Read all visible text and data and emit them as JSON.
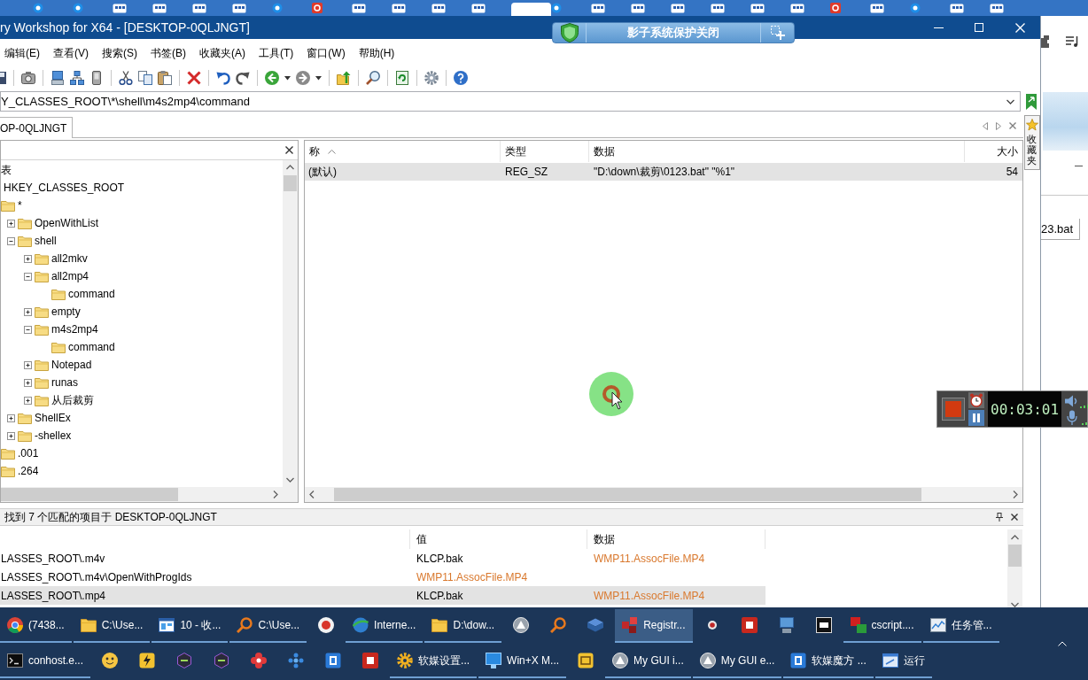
{
  "window": {
    "title": "ry Workshop for X64 - [DESKTOP-0QLJNGT]"
  },
  "overlay_bar": {
    "label": "影子系统保护关闭"
  },
  "menu": [
    "编辑(E)",
    "查看(V)",
    "搜索(S)",
    "书签(B)",
    "收藏夹(A)",
    "工具(T)",
    "窗口(W)",
    "帮助(H)"
  ],
  "address_bar": {
    "value": "Y_CLASSES_ROOT\\*\\shell\\m4s2mp4\\command"
  },
  "tabs": [
    {
      "label": "OP-0QLJNGT",
      "selected": true
    }
  ],
  "favorites_tab": {
    "label": "收藏夹"
  },
  "tree": {
    "items": [
      {
        "label": "表",
        "children": [
          {
            "label": "HKEY_CLASSES_ROOT",
            "children": [
              {
                "label": "*",
                "children": [
                  {
                    "label": "OpenWithList",
                    "expanded": false
                  },
                  {
                    "label": "shell",
                    "expanded": true,
                    "children": [
                      {
                        "label": "all2mkv",
                        "expanded": false
                      },
                      {
                        "label": "all2mp4",
                        "expanded": true,
                        "children": [
                          {
                            "label": "command"
                          }
                        ]
                      },
                      {
                        "label": "empty",
                        "expanded": false
                      },
                      {
                        "label": "m4s2mp4",
                        "expanded": true,
                        "children": [
                          {
                            "label": "command"
                          }
                        ]
                      },
                      {
                        "label": "Notepad",
                        "expanded": false
                      },
                      {
                        "label": "runas",
                        "expanded": false
                      },
                      {
                        "label": "从后裁剪",
                        "expanded": false
                      }
                    ]
                  },
                  {
                    "label": "ShellEx",
                    "expanded": false
                  },
                  {
                    "label": "-shellex",
                    "expanded": false
                  }
                ]
              },
              {
                "label": ".001"
              },
              {
                "label": ".264"
              }
            ]
          }
        ]
      }
    ]
  },
  "values_list": {
    "columns": [
      {
        "label": "称",
        "sort_ascending": true
      },
      {
        "label": "类型"
      },
      {
        "label": "数据"
      },
      {
        "label": "大小"
      }
    ],
    "rows": [
      {
        "name": "(默认)",
        "type": "REG_SZ",
        "data": "\"D:\\down\\裁剪\\0123.bat\" \"%1\"",
        "size": "54",
        "selected": true
      }
    ]
  },
  "search_results": {
    "title": "找到 7 个匹配的项目于 DESKTOP-0QLJNGT",
    "columns": [
      "值",
      "数据"
    ],
    "rows": [
      {
        "key": "LASSES_ROOT\\.m4v",
        "value": {
          "text": "KLCP.bak",
          "matched": false
        },
        "data": {
          "text": "WMP11.AssocFile.MP4",
          "matched": true
        },
        "selected": false
      },
      {
        "key": "LASSES_ROOT\\.m4v\\OpenWithProgIds",
        "value": {
          "text": "WMP11.AssocFile.MP4",
          "matched": true
        },
        "selected": false
      },
      {
        "key": "LASSES_ROOT\\.mp4",
        "value": {
          "text": "KLCP.bak",
          "matched": false
        },
        "data": {
          "text": "WMP11.AssocFile.MP4",
          "matched": true
        },
        "selected": true
      }
    ]
  },
  "recorder": {
    "timer": "00:03:01"
  },
  "background_window": {
    "tab": "23.bat"
  },
  "taskbar": {
    "top_row": [
      {
        "kind": "labeled",
        "label": "(7438...",
        "active": false
      },
      {
        "kind": "labeled",
        "label": "C:\\Use...",
        "active": false
      },
      {
        "kind": "labeled",
        "label": "10 - 收...",
        "active": false
      },
      {
        "kind": "labeled",
        "label": "C:\\Use...",
        "active": false
      },
      {
        "kind": "icon",
        "active": false
      },
      {
        "kind": "labeled",
        "label": "Interne...",
        "active": false
      },
      {
        "kind": "labeled",
        "label": "D:\\dow...",
        "active": false
      },
      {
        "kind": "icon",
        "active": false
      },
      {
        "kind": "icon",
        "active": false
      },
      {
        "kind": "icon",
        "active": false
      },
      {
        "kind": "labeled",
        "label": "Registr...",
        "active": true
      },
      {
        "kind": "icon",
        "active": false
      },
      {
        "kind": "icon",
        "active": false
      },
      {
        "kind": "icon",
        "active": false
      },
      {
        "kind": "icon",
        "active": false
      },
      {
        "kind": "labeled",
        "label": "cscript....",
        "active": false
      },
      {
        "kind": "labeled",
        "label": "任务管...",
        "active": false
      }
    ],
    "bottom_row": [
      {
        "kind": "labeled",
        "label": "conhost.e...",
        "active": false
      },
      {
        "kind": "icon",
        "active": false
      },
      {
        "kind": "icon",
        "active": false
      },
      {
        "kind": "icon",
        "active": false
      },
      {
        "kind": "icon",
        "active": false
      },
      {
        "kind": "icon",
        "active": false
      },
      {
        "kind": "icon",
        "active": false
      },
      {
        "kind": "icon",
        "active": false
      },
      {
        "kind": "icon",
        "active": false
      },
      {
        "kind": "labeled",
        "label": "软媒设置...",
        "active": false
      },
      {
        "kind": "labeled",
        "label": "Win+X M...",
        "active": false
      },
      {
        "kind": "icon",
        "active": false
      },
      {
        "kind": "labeled",
        "label": "My GUI i...",
        "active": false
      },
      {
        "kind": "labeled",
        "label": "My GUI e...",
        "active": false
      },
      {
        "kind": "labeled",
        "label": "软媒魔方 ...",
        "active": false
      },
      {
        "kind": "labeled",
        "label": "运行",
        "active": false
      }
    ]
  }
}
